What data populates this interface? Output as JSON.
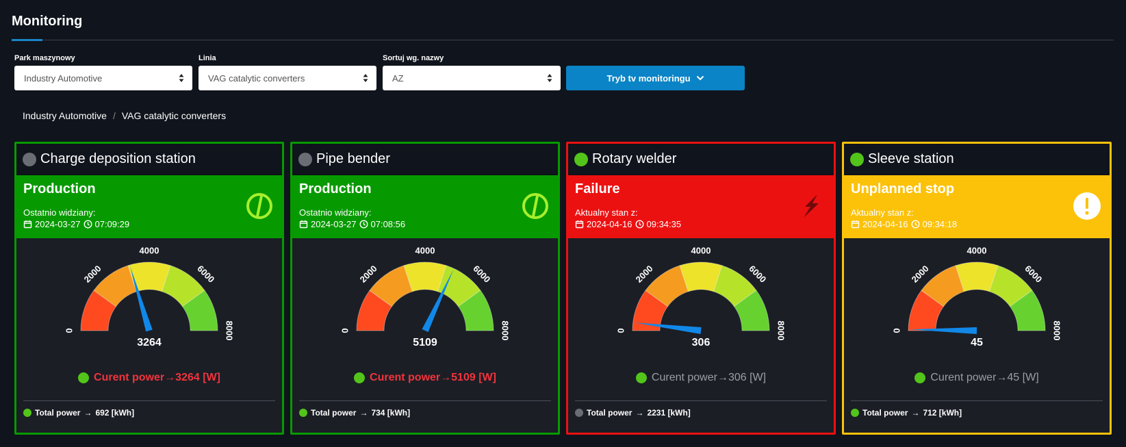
{
  "page": {
    "title": "Monitoring"
  },
  "filters": [
    {
      "label": "Park maszynowy",
      "value": "Industry Automotive"
    },
    {
      "label": "Linia",
      "value": "VAG catalytic converters"
    },
    {
      "label": "Sortuj wg. nazwy",
      "value": "AZ"
    }
  ],
  "tv_button": {
    "label": "Tryb tv monitoringu",
    "icon": "chevron-down-icon"
  },
  "breadcrumb": [
    "Industry Automotive",
    "VAG catalytic converters"
  ],
  "gauge": {
    "min": 0,
    "max": 8000,
    "ticks": [
      "0",
      "2000",
      "4000",
      "6000",
      "8000"
    ],
    "zone_colors": [
      "#ff4a1f",
      "#f59b1f",
      "#ece32a",
      "#b6e22a",
      "#66d12f"
    ]
  },
  "colors": {
    "production": "#079a00",
    "failure": "#ec1111",
    "unplanned": "#fcc20a",
    "dot_gray": "#6a6d73",
    "dot_green": "#52c41a",
    "needle": "#1188e8",
    "power_red": "#f2333c",
    "power_gray": "#9a9ea6"
  },
  "machines": [
    {
      "name": "Charge deposition station",
      "status": "Production",
      "status_icon": "production-icon",
      "seen_label": "Ostatnio widziany:",
      "date": "2024-03-27",
      "time": "07:09:29",
      "value": 3264,
      "value_label": "3264",
      "power_label": "Curent power",
      "power_value": "3264 [W]",
      "total_label": "Total power",
      "total_value": "692 [kWh]",
      "dot_color": "#6a6d73",
      "power_color": "#f2333c",
      "total_dot": "#52c41a",
      "border": "#079a00",
      "band": "#079a00"
    },
    {
      "name": "Pipe bender",
      "status": "Production",
      "status_icon": "production-icon",
      "seen_label": "Ostatnio widziany:",
      "date": "2024-03-27",
      "time": "07:08:56",
      "value": 5109,
      "value_label": "5109",
      "power_label": "Curent power",
      "power_value": "5109 [W]",
      "total_label": "Total power",
      "total_value": "734 [kWh]",
      "dot_color": "#6a6d73",
      "power_color": "#f2333c",
      "total_dot": "#52c41a",
      "border": "#079a00",
      "band": "#079a00"
    },
    {
      "name": "Rotary welder",
      "status": "Failure",
      "status_icon": "lightning-icon",
      "seen_label": "Aktualny stan z:",
      "date": "2024-04-16",
      "time": "09:34:35",
      "value": 306,
      "value_label": "306",
      "power_label": "Curent power",
      "power_value": "306 [W]",
      "total_label": "Total power",
      "total_value": "2231 [kWh]",
      "dot_color": "#52c41a",
      "power_color": "#9a9ea6",
      "total_dot": "#6a6d73",
      "border": "#ec1111",
      "band": "#ec1111"
    },
    {
      "name": "Sleeve station",
      "status": "Unplanned stop",
      "status_icon": "exclamation-icon",
      "seen_label": "Aktualny stan z:",
      "date": "2024-04-16",
      "time": "09:34:18",
      "value": 45,
      "value_label": "45",
      "power_label": "Curent power",
      "power_value": "45 [W]",
      "total_label": "Total power",
      "total_value": "712 [kWh]",
      "dot_color": "#52c41a",
      "power_color": "#9a9ea6",
      "total_dot": "#52c41a",
      "border": "#fcc20a",
      "band": "#fcc20a"
    }
  ]
}
